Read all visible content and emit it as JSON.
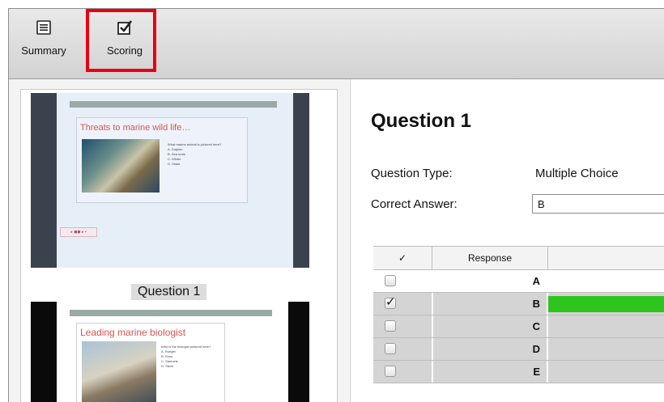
{
  "toolbar": {
    "summary_label": "Summary",
    "scoring_label": "Scoring",
    "summary_icon": "list-icon",
    "scoring_icon": "checkbox-checked-icon",
    "highlight_color": "#e60012"
  },
  "thumbnails": [
    {
      "title": "Threats to marine wild life…",
      "label": "Question 1",
      "question_text": "What marine animal is pictured here?",
      "options": [
        "A. Dolphin",
        "B. Sea turtle",
        "C. Whale",
        "D. Shark"
      ]
    },
    {
      "title": "Leading marine biologist",
      "question_text": "Who is the biologist pictured here?",
      "options": [
        "A. Roeger",
        "B. Ross",
        "C. Samuels",
        "D. Steck"
      ]
    }
  ],
  "question": {
    "heading": "Question 1",
    "type_label": "Question Type:",
    "type_value": "Multiple Choice",
    "answer_label": "Correct Answer:",
    "answer_value": "B"
  },
  "table": {
    "headers": [
      "✓",
      "Response"
    ],
    "rows": [
      {
        "response": "A",
        "checked": false,
        "share": 0
      },
      {
        "response": "B",
        "checked": true,
        "share": 1
      },
      {
        "response": "C",
        "checked": false,
        "share": 0
      },
      {
        "response": "D",
        "checked": false,
        "share": 0
      },
      {
        "response": "E",
        "checked": false,
        "share": 0
      }
    ],
    "bar_color": "#2fc51f",
    "selected_row_color": "#d4d4d4"
  }
}
